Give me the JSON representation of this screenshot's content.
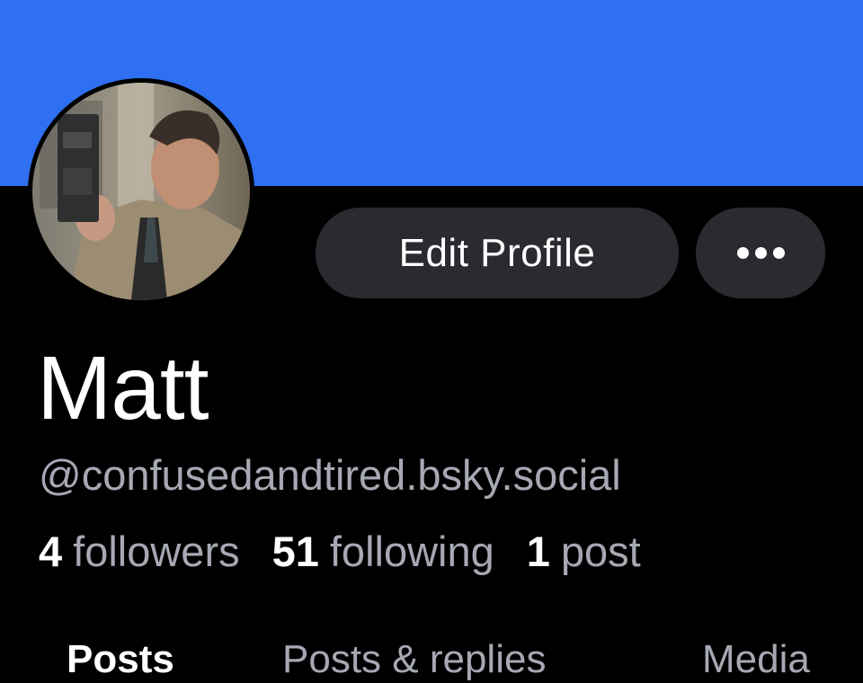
{
  "profile": {
    "name": "Matt",
    "handle": "@confusedandtired.bsky.social",
    "avatar_alt": "man-holding-vhs-tape",
    "banner_color": "#2f6ff2"
  },
  "actions": {
    "edit_label": "Edit Profile",
    "more_icon": "ellipsis-icon"
  },
  "stats": {
    "followers_count": "4",
    "followers_label": "followers",
    "following_count": "51",
    "following_label": "following",
    "posts_count": "1",
    "posts_label": "post"
  },
  "tabs": [
    {
      "label": "Posts",
      "active": true
    },
    {
      "label": "Posts & replies",
      "active": false
    },
    {
      "label": "Media",
      "active": false
    }
  ]
}
